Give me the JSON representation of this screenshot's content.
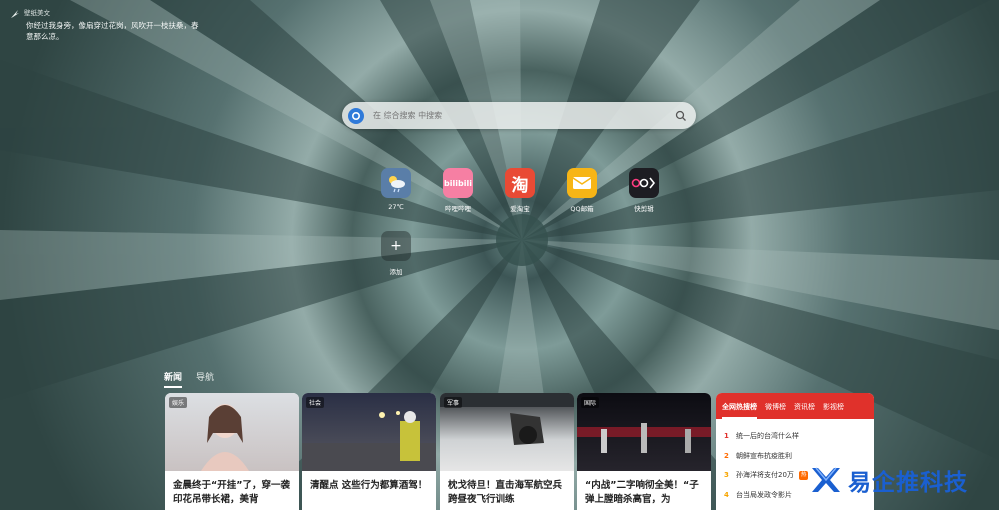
{
  "colors": {
    "accent": "#e0312b",
    "search_engine": "#2f7ad9",
    "watermark": "#1a5fd0"
  },
  "quote": {
    "source": "壁纸美文",
    "text": "你经过我身旁，像扇穿过花岗，风吹开一枝扶桑，春意那么凉。"
  },
  "search": {
    "placeholder": "在 综合搜索 中搜索",
    "engine_icon": "search-engine-icon",
    "button_icon": "search-icon"
  },
  "apps": [
    {
      "label": "27℃",
      "icon": "weather-icon"
    },
    {
      "label": "哔哩哔哩",
      "icon": "bilibili-icon"
    },
    {
      "label": "爱淘宝",
      "icon": "taobao-icon"
    },
    {
      "label": "QQ邮箱",
      "icon": "qqmail-icon"
    },
    {
      "label": "快剪辑",
      "icon": "kuaijianji-icon"
    },
    {
      "label": "添加",
      "icon": "plus-icon"
    }
  ],
  "feed_tabs": [
    {
      "label": "新闻"
    },
    {
      "label": "导航"
    }
  ],
  "news": [
    {
      "tag": "娱乐",
      "title": "金晨终于“开挂”了，穿一袭印花吊带长裙，美背"
    },
    {
      "tag": "社会",
      "title": "清醒点 这些行为都算酒驾！"
    },
    {
      "tag": "军事",
      "title": "枕戈待旦！直击海军航空兵跨昼夜飞行训练"
    },
    {
      "tag": "国际",
      "title": "“内战”二字响彻全美！“子弹上膛暗杀高官，为"
    }
  ],
  "hot": {
    "tabs": [
      "全网热搜榜",
      "微博榜",
      "资讯榜",
      "影视榜"
    ],
    "items": [
      {
        "rank": "1",
        "text": "统一后的台湾什么样",
        "badge": ""
      },
      {
        "rank": "2",
        "text": "朝鲜宣布抗疫胜利",
        "badge": ""
      },
      {
        "rank": "3",
        "text": "孙海洋将支付20万",
        "badge": "热"
      },
      {
        "rank": "4",
        "text": "台当局发政令影片",
        "badge": ""
      }
    ]
  },
  "watermark": {
    "text": "易企推科技",
    "icon": "logo-icon"
  }
}
